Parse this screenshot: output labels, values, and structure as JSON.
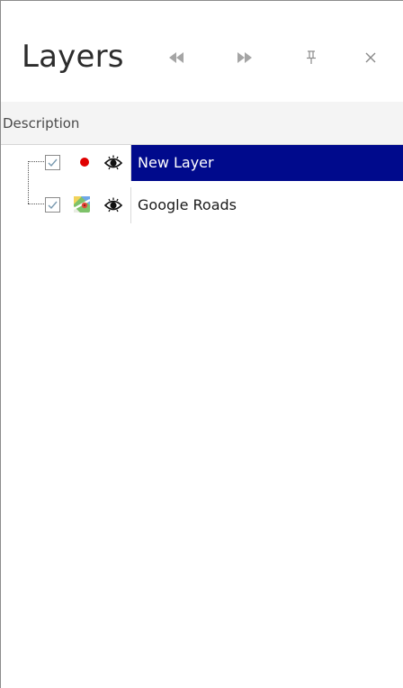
{
  "panel": {
    "title": "Layers",
    "buttons": {
      "prev": "back-double-arrow-icon",
      "next": "forward-double-arrow-icon",
      "pin": "pin-icon",
      "close": "close-icon"
    }
  },
  "columns": {
    "description": "Description"
  },
  "layers": [
    {
      "label": "New Layer",
      "checked": true,
      "selected": true,
      "status_icon": "red-dot-icon",
      "visibility_icon": "eye-icon"
    },
    {
      "label": "Google Roads",
      "checked": true,
      "selected": false,
      "status_icon": "google-maps-icon",
      "visibility_icon": "eye-icon"
    }
  ],
  "colors": {
    "selection": "#000a8c",
    "active_dot": "#e00000"
  }
}
